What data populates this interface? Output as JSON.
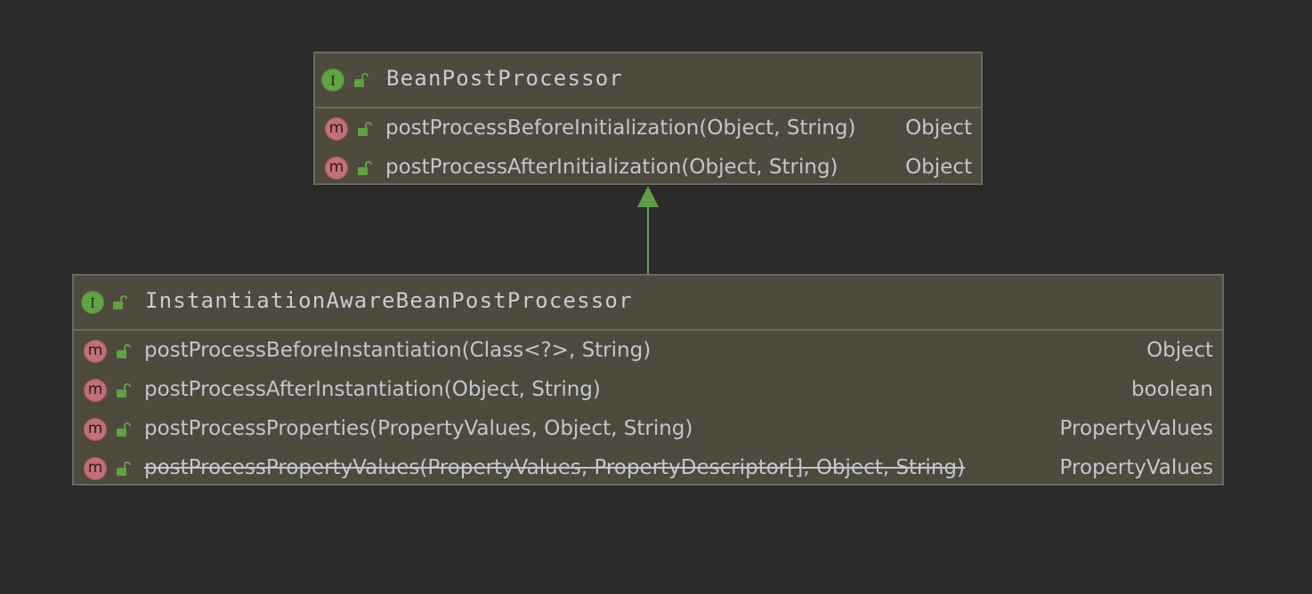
{
  "diagram": {
    "parent": {
      "name": "BeanPostProcessor",
      "kind_badge": "I",
      "methods": [
        {
          "signature": "postProcessBeforeInitialization(Object, String)",
          "return_type": "Object",
          "deprecated": false
        },
        {
          "signature": "postProcessAfterInitialization(Object, String)",
          "return_type": "Object",
          "deprecated": false
        }
      ]
    },
    "child": {
      "name": "InstantiationAwareBeanPostProcessor",
      "kind_badge": "I",
      "methods": [
        {
          "signature": "postProcessBeforeInstantiation(Class<?>, String)",
          "return_type": "Object",
          "deprecated": false
        },
        {
          "signature": "postProcessAfterInstantiation(Object, String)",
          "return_type": "boolean",
          "deprecated": false
        },
        {
          "signature": "postProcessProperties(PropertyValues, Object, String)",
          "return_type": "PropertyValues",
          "deprecated": false
        },
        {
          "signature": "postProcessPropertyValues(PropertyValues, PropertyDescriptor[], Object, String)",
          "return_type": "PropertyValues",
          "deprecated": true
        }
      ]
    },
    "method_badge": "m",
    "icons": {
      "interface": "interface-icon",
      "method": "method-icon",
      "visibility": "public-lock-icon",
      "relation": "inheritance-arrow"
    },
    "colors": {
      "background": "#2b2b2b",
      "box_fill": "#4e4a3e",
      "box_border": "#6a6a62",
      "interface_badge": "#62a345",
      "method_badge": "#c07178",
      "lock": "#5fa043",
      "arrow": "#5f9e45",
      "text": "#c3c6cc"
    }
  }
}
